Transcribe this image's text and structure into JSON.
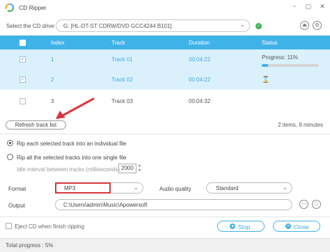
{
  "window": {
    "title": "CD Ripper",
    "controls": [
      "-",
      "▢",
      "✕"
    ]
  },
  "drive": {
    "label": "Select the CD drive",
    "value": "G: [HL-DT-ST CDRW/DVD GCC4244 B101]"
  },
  "table": {
    "headers": {
      "index": "Index",
      "track": "Track",
      "duration": "Duration",
      "status": "Status"
    },
    "rows": [
      {
        "index": "1",
        "track": "Track 01",
        "duration": "00:04:22",
        "checked": true,
        "selected": true,
        "status": "Progress: 11%",
        "progress": 0.11
      },
      {
        "index": "2",
        "track": "Track 02",
        "duration": "00:04:22",
        "checked": true,
        "selected": true,
        "status": "waiting"
      },
      {
        "index": "3",
        "track": "Track 03",
        "duration": "00:04:32",
        "checked": false,
        "selected": false,
        "status": ""
      }
    ]
  },
  "refresh_label": "Refresh track list",
  "items_info": "2 items, 9 minutes",
  "rip_options": {
    "individual": "Rip each selected track into an individual file",
    "single": "Rip all the selected tracks into one single file",
    "selected": "individual",
    "idle_label": "Idle interval between tracks (milliseconds)",
    "idle_value": "2000"
  },
  "format": {
    "label": "Format",
    "value": "MP3"
  },
  "quality": {
    "label": "Audio quality",
    "value": "Standard"
  },
  "output": {
    "label": "Output",
    "value": "C:\\Users\\admin\\Music\\Apowersoft"
  },
  "eject_label": "Eject CD when finish ripping",
  "stop_label": "Stop",
  "close_label": "Close",
  "total_progress": "Total progress : 5%",
  "colors": {
    "accent": "#3fb2e8",
    "highlight": "#d9363e",
    "ok": "#35b34a",
    "selected_row": "#daf1fb"
  }
}
